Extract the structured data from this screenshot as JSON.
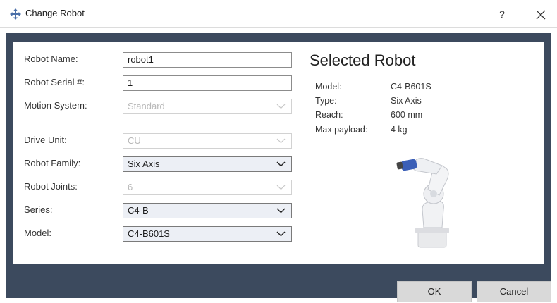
{
  "window": {
    "title": "Change Robot",
    "help_label": "?"
  },
  "form": {
    "robot_name": {
      "label": "Robot Name:",
      "value": "robot1"
    },
    "robot_serial": {
      "label": "Robot Serial #:",
      "value": "1"
    },
    "motion_system": {
      "label": "Motion System:",
      "value": "Standard"
    },
    "drive_unit": {
      "label": "Drive Unit:",
      "value": "CU"
    },
    "robot_family": {
      "label": "Robot Family:",
      "value": "Six Axis"
    },
    "robot_joints": {
      "label": "Robot Joints:",
      "value": "6"
    },
    "series": {
      "label": "Series:",
      "value": "C4-B"
    },
    "model": {
      "label": "Model:",
      "value": "C4-B601S"
    }
  },
  "selected": {
    "title": "Selected Robot",
    "model_label": "Model:",
    "model_value": "C4-B601S",
    "type_label": "Type:",
    "type_value": "Six Axis",
    "reach_label": "Reach:",
    "reach_value": "600  mm",
    "payload_label": "Max payload:",
    "payload_value": "4  kg"
  },
  "buttons": {
    "ok": "OK",
    "cancel": "Cancel"
  },
  "colors": {
    "panel_bg": "#3c4a5e",
    "enabled_select_bg": "#eceff5",
    "robot_accent": "#3b5fb7"
  }
}
